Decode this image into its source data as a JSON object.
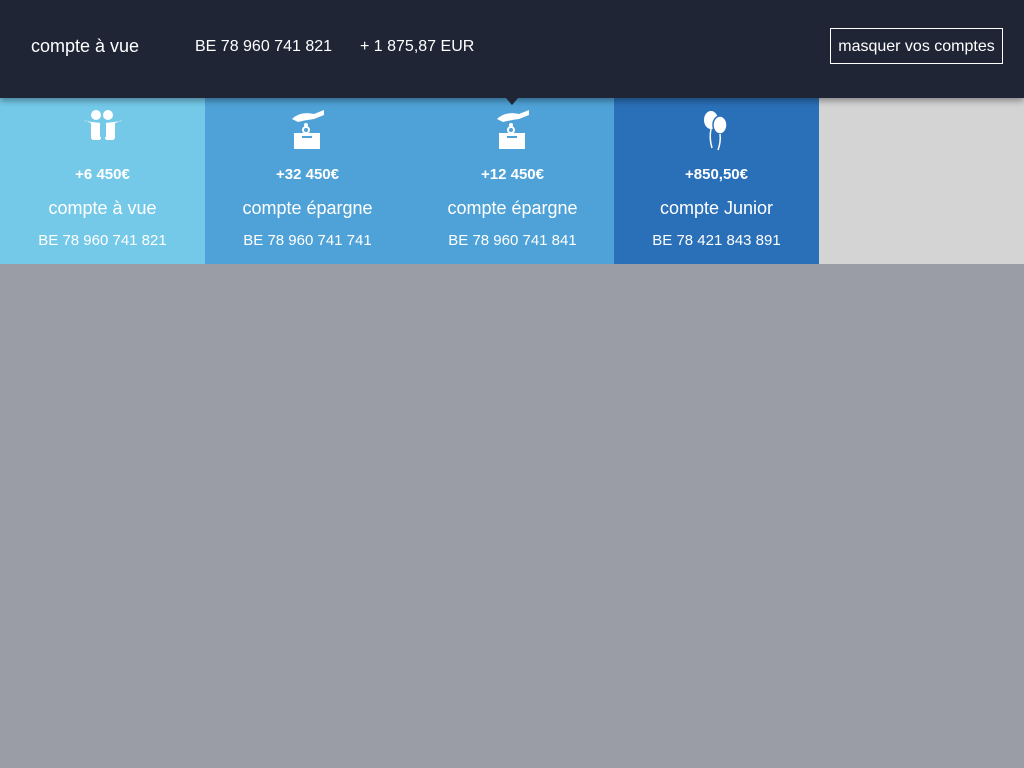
{
  "header": {
    "title": "compte à vue",
    "iban": "BE 78 960 741 821",
    "balance": "+ 1 875,87 EUR",
    "toggle_label": "masquer vos comptes"
  },
  "accounts": [
    {
      "amount": "+6 450€",
      "name": "compte à vue",
      "iban": "BE 78 960 741 821",
      "icon": "two-people-icon",
      "color": "#74c9e9"
    },
    {
      "amount": "+32 450€",
      "name": "compte épargne",
      "iban": "BE 78 960 741 741",
      "icon": "savings-box-icon",
      "color": "#4fa2d7"
    },
    {
      "amount": "+12 450€",
      "name": "compte épargne",
      "iban": "BE 78 960 741 841",
      "icon": "savings-box-icon",
      "color": "#4fa2d7"
    },
    {
      "amount": "+850,50€",
      "name": "compte Junior",
      "iban": "BE 78 421 843 891",
      "icon": "balloons-icon",
      "color": "#2a70b8"
    }
  ]
}
